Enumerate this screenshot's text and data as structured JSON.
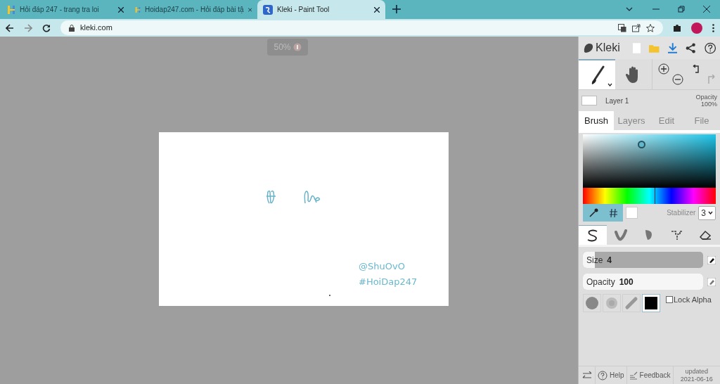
{
  "browser": {
    "tabs": [
      {
        "title": "Hỏi đáp 247 - trang tra loi",
        "selected": false
      },
      {
        "title": "Hoidap247.com - Hỏi đáp bài tậ",
        "selected": false
      },
      {
        "title": "Kleki - Paint Tool",
        "selected": true
      }
    ],
    "url": "kleki.com"
  },
  "zoom_label": "50%",
  "canvas": {
    "texts": [
      "@ShuOvO",
      "#HoiDap247"
    ]
  },
  "panel": {
    "logo": "Kleki",
    "tools": [
      {
        "kind": "brush",
        "selected": true
      },
      {
        "kind": "hand",
        "selected": false
      }
    ],
    "layer": {
      "name": "Layer 1",
      "opacity_label": "Opacity",
      "opacity_value": "100%"
    },
    "tabs": [
      {
        "label": "Brush",
        "selected": true
      },
      {
        "label": "Layers",
        "selected": false
      },
      {
        "label": "Edit",
        "selected": false
      },
      {
        "label": "File",
        "selected": false
      }
    ],
    "hue": {
      "level": 0.54
    },
    "stabilizer": {
      "label": "Stabilizer",
      "value": "3"
    },
    "brushes": [
      {
        "kind": "pen",
        "selected": true
      },
      {
        "kind": "blend",
        "selected": false
      },
      {
        "kind": "sketchy",
        "selected": false
      },
      {
        "kind": "pixel",
        "selected": false
      },
      {
        "kind": "eraser",
        "selected": false
      }
    ],
    "sliders": [
      {
        "label": "Size",
        "value": "4",
        "level": 0.1
      },
      {
        "label": "Opacity",
        "value": "100",
        "level": 1
      }
    ],
    "tips": [
      {
        "kind": "circle",
        "selected": false
      },
      {
        "kind": "soft",
        "selected": false
      },
      {
        "kind": "stroke",
        "selected": false
      },
      {
        "kind": "square",
        "selected": true
      }
    ],
    "lock_alpha": {
      "label": "Lock Alpha",
      "checked": false
    },
    "footer": {
      "help": "Help",
      "feedback": "Feedback",
      "updated": "updated",
      "date": "2021-06-16"
    }
  }
}
